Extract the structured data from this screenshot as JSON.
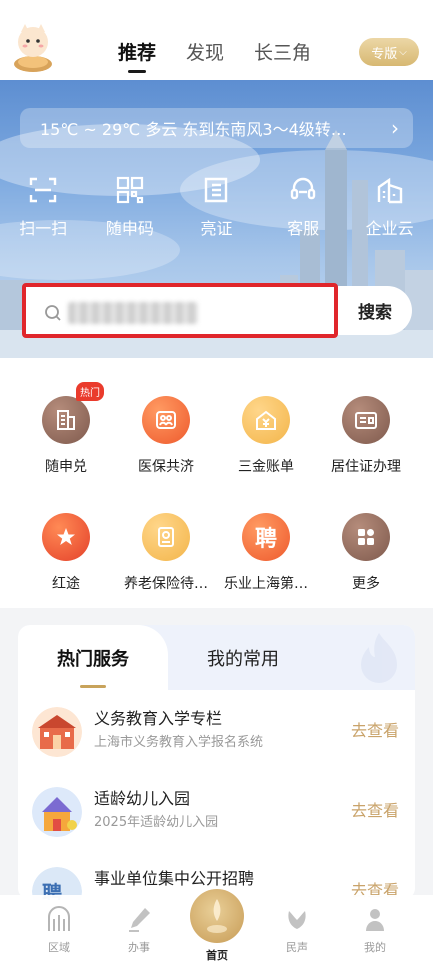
{
  "header": {
    "mascot_icon": "mascot-icon",
    "tabs": [
      {
        "label": "推荐"
      },
      {
        "label": "发现"
      },
      {
        "label": "长三角"
      }
    ],
    "edition_label": "专版"
  },
  "hero": {
    "weather_text": "15℃ ~ 29℃  多云  东到东南风3～4级转…",
    "quick_actions": [
      {
        "label": "扫一扫",
        "icon": "scan-icon"
      },
      {
        "label": "随申码",
        "icon": "qr-code-icon"
      },
      {
        "label": "亮证",
        "icon": "certificate-icon"
      },
      {
        "label": "客服",
        "icon": "customer-service-icon"
      },
      {
        "label": "企业云",
        "icon": "building-icon"
      }
    ],
    "search": {
      "placeholder": "",
      "button_label": "搜索"
    }
  },
  "services": [
    {
      "label": "随申兑",
      "icon": "document-icon",
      "badge": "热门"
    },
    {
      "label": "医保共济",
      "icon": "family-icon"
    },
    {
      "label": "三金账单",
      "icon": "coin-icon"
    },
    {
      "label": "居住证办理",
      "icon": "id-card-icon"
    },
    {
      "label": "红途",
      "icon": "star-icon"
    },
    {
      "label": "养老保险待…",
      "icon": "pension-icon"
    },
    {
      "label": "乐业上海第…",
      "icon": "hire-icon"
    },
    {
      "label": "更多",
      "icon": "more-grid-icon"
    }
  ],
  "hot_services": {
    "tabs": [
      {
        "label": "热门服务"
      },
      {
        "label": "我的常用"
      }
    ],
    "items": [
      {
        "title": "义务教育入学专栏",
        "subtitle": "上海市义务教育入学报名系统",
        "action": "去查看"
      },
      {
        "title": "适龄幼儿入园",
        "subtitle": "2025年适龄幼儿入园",
        "action": "去查看"
      },
      {
        "title": "事业单位集中公开招聘",
        "subtitle": "",
        "action": "去查看"
      }
    ]
  },
  "bottom_nav": [
    {
      "label": "区域",
      "icon": "region-icon"
    },
    {
      "label": "办事",
      "icon": "pen-icon"
    },
    {
      "label": "首页",
      "icon": "home-icon"
    },
    {
      "label": "民声",
      "icon": "voice-icon"
    },
    {
      "label": "我的",
      "icon": "profile-icon"
    }
  ],
  "colors": {
    "accent_gold": "#c9a36a",
    "highlight_red": "#e0262b",
    "badge_red": "#ea3b2c"
  }
}
